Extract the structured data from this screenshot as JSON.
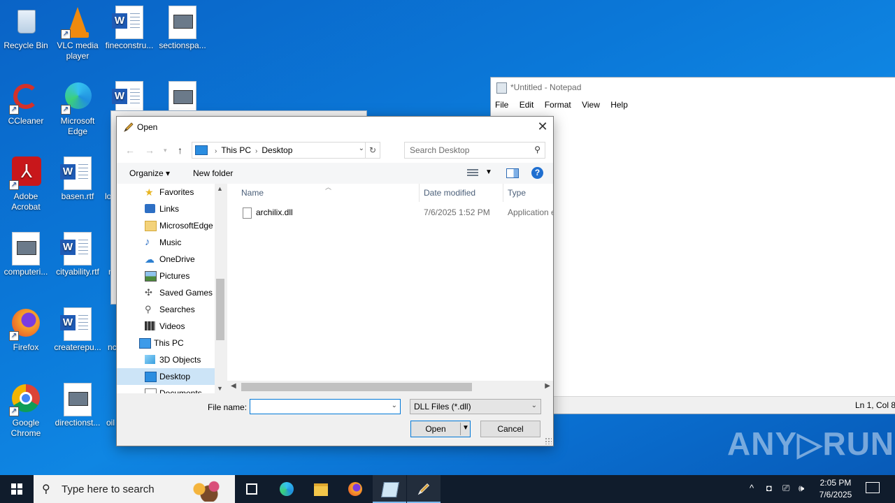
{
  "desktop": {
    "icons": [
      {
        "label": "Recycle Bin"
      },
      {
        "label": "VLC media player"
      },
      {
        "label": "fineconstru..."
      },
      {
        "label": "sectionspa..."
      },
      {
        "label": "CCleaner"
      },
      {
        "label": "Microsoft Edge"
      },
      {
        "label": "Adobe Acrobat"
      },
      {
        "label": "basen.rtf"
      },
      {
        "label": "computeri..."
      },
      {
        "label": "cityability.rtf"
      },
      {
        "label": "Firefox"
      },
      {
        "label": "createrepu..."
      },
      {
        "label": "Google Chrome"
      },
      {
        "label": "directionst..."
      }
    ],
    "partial_labels": [
      "lo",
      "n",
      "nc",
      "oil"
    ]
  },
  "notepad": {
    "title": "*Untitled - Notepad",
    "menu": [
      "File",
      "Edit",
      "Format",
      "View",
      "Help"
    ],
    "status": "Ln 1, Col 8"
  },
  "dialog": {
    "title": "Open",
    "close_glyph": "✕",
    "breadcrumb": [
      "This PC",
      "Desktop"
    ],
    "search_placeholder": "Search Desktop",
    "toolbar": {
      "organize": "Organize ▾",
      "new_folder": "New folder",
      "help": "?"
    },
    "nav_items": [
      {
        "label": "Favorites",
        "icon": "star-icon"
      },
      {
        "label": "Links",
        "icon": "links-icon"
      },
      {
        "label": "MicrosoftEdge",
        "icon": "folder-icon"
      },
      {
        "label": "Music",
        "icon": "music-icon"
      },
      {
        "label": "OneDrive",
        "icon": "cloud-icon"
      },
      {
        "label": "Pictures",
        "icon": "pictures-icon"
      },
      {
        "label": "Saved Games",
        "icon": "games-icon"
      },
      {
        "label": "Searches",
        "icon": "search-icon"
      },
      {
        "label": "Videos",
        "icon": "video-icon"
      },
      {
        "label": "This PC",
        "icon": "computer-icon"
      },
      {
        "label": "3D Objects",
        "icon": "cube-icon"
      },
      {
        "label": "Desktop",
        "icon": "desktop-icon"
      },
      {
        "label": "Documents",
        "icon": "documents-icon"
      }
    ],
    "columns": {
      "name": "Name",
      "date": "Date modified",
      "type": "Type"
    },
    "files": [
      {
        "name": "archilix.dll",
        "date": "7/6/2025 1:52 PM",
        "type": "Application e"
      }
    ],
    "file_name_label": "File name:",
    "file_name_value": "",
    "file_type": "DLL Files (*.dll)",
    "open_label": "Open",
    "cancel_label": "Cancel"
  },
  "watermark": "ANY▷RUN",
  "taskbar": {
    "search_placeholder": "Type here to search",
    "time": "2:05 PM",
    "date": "7/6/2025"
  },
  "colors": {
    "accent": "#0078d7",
    "taskbar": "#101c2c",
    "selection": "#cce4f7"
  }
}
